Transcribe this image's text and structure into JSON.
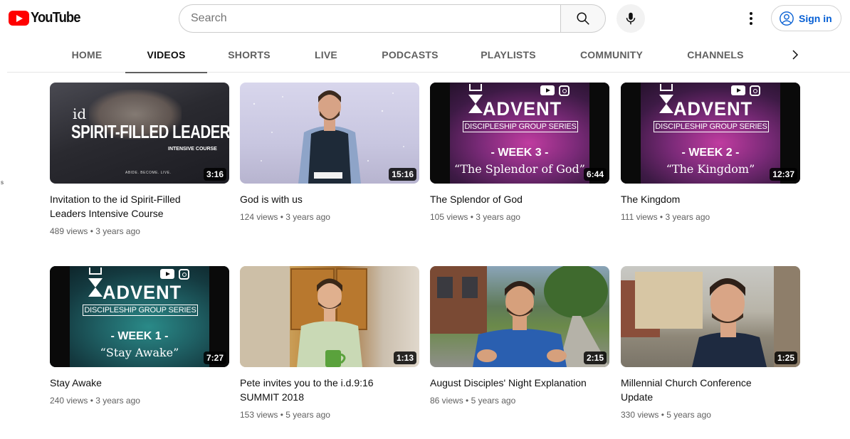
{
  "masthead": {
    "logo_text": "YouTube",
    "search_placeholder": "Search",
    "signin_label": "Sign in"
  },
  "tabs": [
    {
      "label": "HOME",
      "active": false
    },
    {
      "label": "VIDEOS",
      "active": true
    },
    {
      "label": "SHORTS",
      "active": false
    },
    {
      "label": "LIVE",
      "active": false
    },
    {
      "label": "PODCASTS",
      "active": false
    },
    {
      "label": "PLAYLISTS",
      "active": false
    },
    {
      "label": "COMMUNITY",
      "active": false
    },
    {
      "label": "CHANNELS",
      "active": false
    }
  ],
  "edge_text": "s",
  "videos": [
    {
      "title": "Invitation to the id Spirit-Filled Leaders Intensive Course",
      "views": "489 views",
      "age": "3 years ago",
      "duration": "3:16"
    },
    {
      "title": "God is with us",
      "views": "124 views",
      "age": "3 years ago",
      "duration": "15:16"
    },
    {
      "title": "The Splendor of God",
      "views": "105 views",
      "age": "3 years ago",
      "duration": "6:44"
    },
    {
      "title": "The Kingdom",
      "views": "111 views",
      "age": "3 years ago",
      "duration": "12:37"
    },
    {
      "title": "Stay Awake",
      "views": "240 views",
      "age": "3 years ago",
      "duration": "7:27"
    },
    {
      "title": "Pete invites you to the i.d.9:16 SUMMIT 2018",
      "views": "153 views",
      "age": "5 years ago",
      "duration": "1:13"
    },
    {
      "title": "August Disciples' Night Explanation",
      "views": "86 views",
      "age": "5 years ago",
      "duration": "2:15"
    },
    {
      "title": "Millennial Church Conference Update",
      "views": "330 views",
      "age": "5 years ago",
      "duration": "1:25"
    }
  ],
  "thumbnails": {
    "id": {
      "small": "id",
      "big": "SPIRIT-FILLED LEADERS",
      "sub": "INTENSIVE COURSE",
      "tag": "ABIDE. BECOME. LIVE."
    },
    "advent": {
      "word": "ADVENT",
      "series": "DISCIPLESHIP GROUP SERIES",
      "week3": "- WEEK 3 -",
      "sub3": "“The Splendor of God”",
      "week2": "- WEEK 2 -",
      "sub2": "“The Kingdom”",
      "week1": "- WEEK 1 -",
      "sub1": "“Stay Awake”"
    }
  },
  "icons": {
    "search": "search-icon",
    "mic": "microphone-icon",
    "more": "more-vertical-icon",
    "account": "account-circle-icon",
    "next": "chevron-right-icon"
  },
  "colors": {
    "brand_red": "#ff0000",
    "link_blue": "#065fd4",
    "meta_gray": "#606060"
  }
}
